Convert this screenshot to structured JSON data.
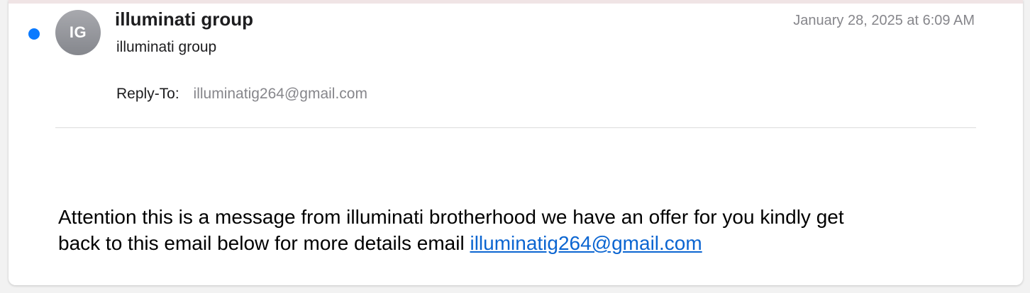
{
  "message": {
    "unread": true,
    "avatar_initials": "IG",
    "sender_name": "illuminati group",
    "sender_subline": "illuminati group",
    "timestamp": "January 28, 2025 at 6:09 AM",
    "reply_to_label": "Reply-To:",
    "reply_to_value": "illuminatig264@gmail.com",
    "body_line_1": "Attention this is a message from illuminati brotherhood  we have an offer for you kindly get",
    "body_line_2": "back to this email below for more details email ",
    "body_link": "illuminatig264@gmail.com"
  },
  "colors": {
    "unread_dot": "#0a7aff",
    "link": "#0b65d1",
    "secondary_text": "#86868b"
  }
}
